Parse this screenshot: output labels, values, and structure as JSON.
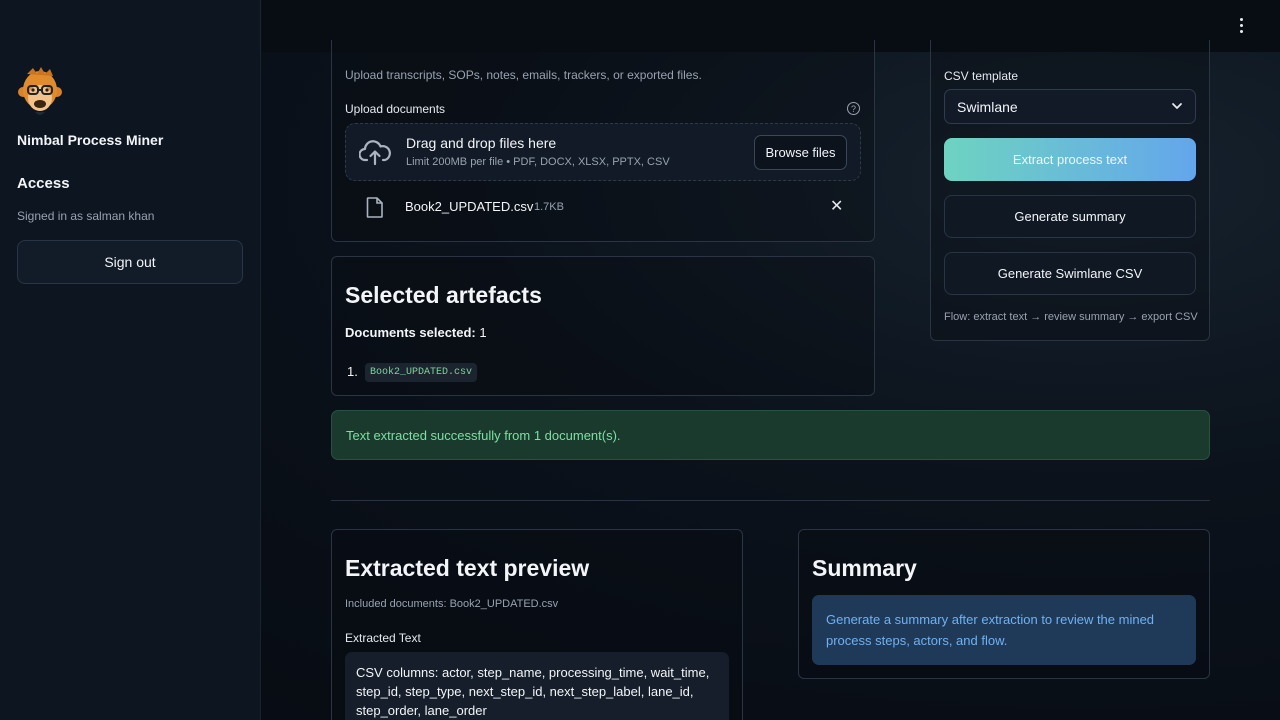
{
  "sidebar": {
    "app_name": "Nimbal Process Miner",
    "access_title": "Access",
    "signed_in_text": "Signed in as salman khan",
    "sign_out_label": "Sign out"
  },
  "upload": {
    "hint": "Upload transcripts, SOPs, notes, emails, trackers, or exported files.",
    "label": "Upload documents",
    "help_glyph": "?",
    "dropzone_title": "Drag and drop files here",
    "dropzone_limit": "Limit 200MB per file • PDF, DOCX, XLSX, PPTX, CSV",
    "browse_label": "Browse files",
    "file": {
      "name": "Book2_UPDATED.csv",
      "size": "1.7KB",
      "remove_glyph": "✕"
    }
  },
  "artefacts": {
    "title": "Selected artefacts",
    "count_label": "Documents selected:",
    "count_value": "1",
    "items": [
      {
        "num": "1.",
        "name": "Book2_UPDATED.csv"
      }
    ]
  },
  "success_message": "Text extracted successfully from 1 document(s).",
  "preview": {
    "title": "Extracted text preview",
    "included": "Included documents: Book2_UPDATED.csv",
    "text_label": "Extracted Text",
    "text_content": "CSV columns: actor, step_name, processing_time, wait_time, step_id, step_type, next_step_id, next_step_label, lane_id, step_order, lane_order"
  },
  "summary": {
    "title": "Summary",
    "info": "Generate a summary after extraction to review the mined process steps, actors, and flow."
  },
  "controls": {
    "csv_template_label": "CSV template",
    "csv_template_value": "Swimlane",
    "extract_label": "Extract process text",
    "summary_label": "Generate summary",
    "swimlane_label": "Generate Swimlane CSV",
    "flow_text": "Flow: extract text → review summary → export CSV"
  },
  "colors": {
    "accent_gradient_start": "#6ed3c1",
    "accent_gradient_end": "#63a6ec",
    "success_text": "#7be0a0",
    "info_text": "#6fb1f3"
  },
  "icons": {
    "logo": "monkey-logo-icon",
    "menu": "more-vertical-icon",
    "upload": "cloud-upload-icon",
    "file": "file-icon",
    "remove": "close-icon",
    "help": "help-icon",
    "select": "chevron-down-icon"
  }
}
